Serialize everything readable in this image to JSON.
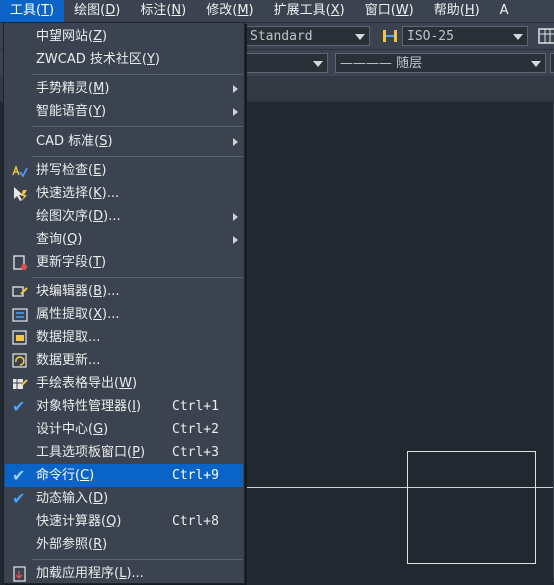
{
  "menubar": {
    "items": [
      {
        "label": "工具",
        "key": "T"
      },
      {
        "label": "绘图",
        "key": "D"
      },
      {
        "label": "标注",
        "key": "N"
      },
      {
        "label": "修改",
        "key": "M"
      },
      {
        "label": "扩展工具",
        "key": "X"
      },
      {
        "label": "窗口",
        "key": "W"
      },
      {
        "label": "帮助",
        "key": "H"
      },
      {
        "label": "A",
        "key": ""
      }
    ]
  },
  "toolbar": {
    "text_style": "Standard",
    "dim_style": "ISO-25",
    "linetype": "———— 随层"
  },
  "menu": {
    "items": [
      {
        "label": "中望网站",
        "key": "Z",
        "tail": ""
      },
      {
        "label": "ZWCAD 技术社区",
        "key": "Y",
        "tail": ""
      },
      {
        "label": "手势精灵",
        "key": "M",
        "tail": ""
      },
      {
        "label": "智能语音",
        "key": "Y",
        "tail": ""
      },
      {
        "label": "CAD 标准",
        "key": "S",
        "tail": ""
      },
      {
        "label": "拼写检查",
        "key": "E",
        "tail": ""
      },
      {
        "label": "快速选择",
        "key": "K",
        "tail": "..."
      },
      {
        "label": "绘图次序",
        "key": "D",
        "tail": "..."
      },
      {
        "label": "查询",
        "key": "Q",
        "tail": ""
      },
      {
        "label": "更新字段",
        "key": "T",
        "tail": ""
      },
      {
        "label": "块编辑器",
        "key": "B",
        "tail": "..."
      },
      {
        "label": "属性提取",
        "key": "X",
        "tail": "..."
      },
      {
        "label": "数据提取...",
        "key": "",
        "tail": ""
      },
      {
        "label": "数据更新...",
        "key": "",
        "tail": ""
      },
      {
        "label": "手绘表格导出",
        "key": "W",
        "tail": ""
      },
      {
        "label": "对象特性管理器",
        "key": "I",
        "tail": "",
        "shortcut": "Ctrl+1"
      },
      {
        "label": "设计中心",
        "key": "G",
        "tail": "",
        "shortcut": "Ctrl+2"
      },
      {
        "label": "工具选项板窗口",
        "key": "P",
        "tail": "",
        "shortcut": "Ctrl+3"
      },
      {
        "label": "命令行",
        "key": "C",
        "tail": "",
        "shortcut": "Ctrl+9"
      },
      {
        "label": "动态输入",
        "key": "D",
        "tail": ""
      },
      {
        "label": "快速计算器",
        "key": "Q",
        "tail": "",
        "shortcut": "Ctrl+8"
      },
      {
        "label": "外部参照",
        "key": "R",
        "tail": ""
      },
      {
        "label": "加载应用程序",
        "key": "L",
        "tail": "..."
      }
    ]
  },
  "colors": {
    "highlight": "#0a64c8",
    "menu_bg": "#3b4350",
    "canvas_bg": "#212830",
    "check": "#4aa3ff"
  }
}
